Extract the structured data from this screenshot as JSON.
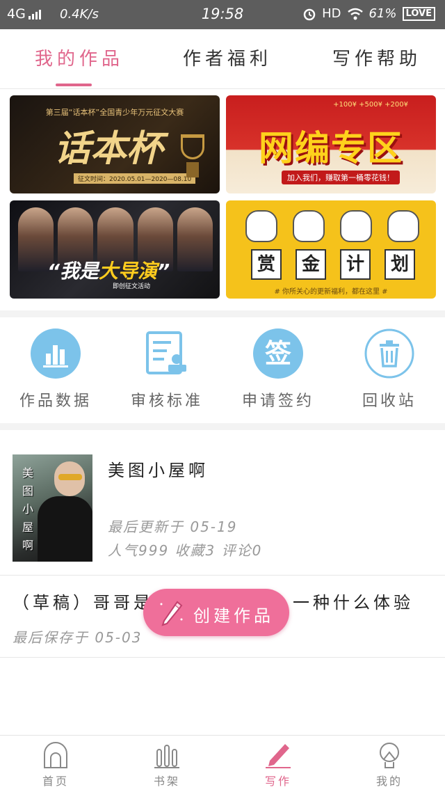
{
  "status_bar": {
    "network": "4G",
    "speed": "0.4K/s",
    "time": "19:58",
    "hd": "HD",
    "battery": "61%",
    "love": "LOVE"
  },
  "tabs": [
    {
      "label": "我的作品",
      "active": true
    },
    {
      "label": "作者福利",
      "active": false
    },
    {
      "label": "写作帮助",
      "active": false
    }
  ],
  "banners": {
    "b1": {
      "subtitle": "第三届“话本杯”全国青少年万元征文大赛",
      "title": "话本杯",
      "date": "征文时间：2020.05.01—2020—08.10"
    },
    "b2": {
      "bonus": "+100¥  +500¥  +200¥",
      "title": "网编专区",
      "strip": "加入我们，赚取第一桶零花钱！"
    },
    "b3": {
      "title_prefix": "“我是",
      "title_em": "大导演",
      "title_suffix": "”",
      "tag": "即创征文活动"
    },
    "b4": {
      "words": [
        "赏",
        "金",
        "计",
        "划"
      ],
      "note": "# 你所关心的更新福利，都在这里 #"
    }
  },
  "tools": [
    {
      "label": "作品数据",
      "icon": "bar-chart-icon"
    },
    {
      "label": "审核标准",
      "icon": "document-stamp-icon"
    },
    {
      "label": "申请签约",
      "icon": "sign-badge-icon",
      "glyph": "签"
    },
    {
      "label": "回收站",
      "icon": "trash-icon"
    }
  ],
  "works": [
    {
      "title": "美图小屋啊",
      "cover_text": "美图小屋啊",
      "updated": "最后更新于 05-19",
      "stats": "人气999 收藏3 评论0"
    }
  ],
  "draft": {
    "title": "（草稿）哥哥是……一种什么体验",
    "title_left": "（草稿）哥哥是",
    "title_right": "一种什么体验",
    "saved": "最后保存于 05-03"
  },
  "fab": {
    "label": "创建作品"
  },
  "bottom_nav": [
    {
      "label": "首页",
      "icon": "home-icon",
      "active": false
    },
    {
      "label": "书架",
      "icon": "bookshelf-icon",
      "active": false
    },
    {
      "label": "写作",
      "icon": "pencil-icon",
      "active": true
    },
    {
      "label": "我的",
      "icon": "profile-icon",
      "active": false
    }
  ],
  "colors": {
    "accent": "#e0668c",
    "fab": "#ef6f9a",
    "tool_blue": "#7cc3ea"
  }
}
